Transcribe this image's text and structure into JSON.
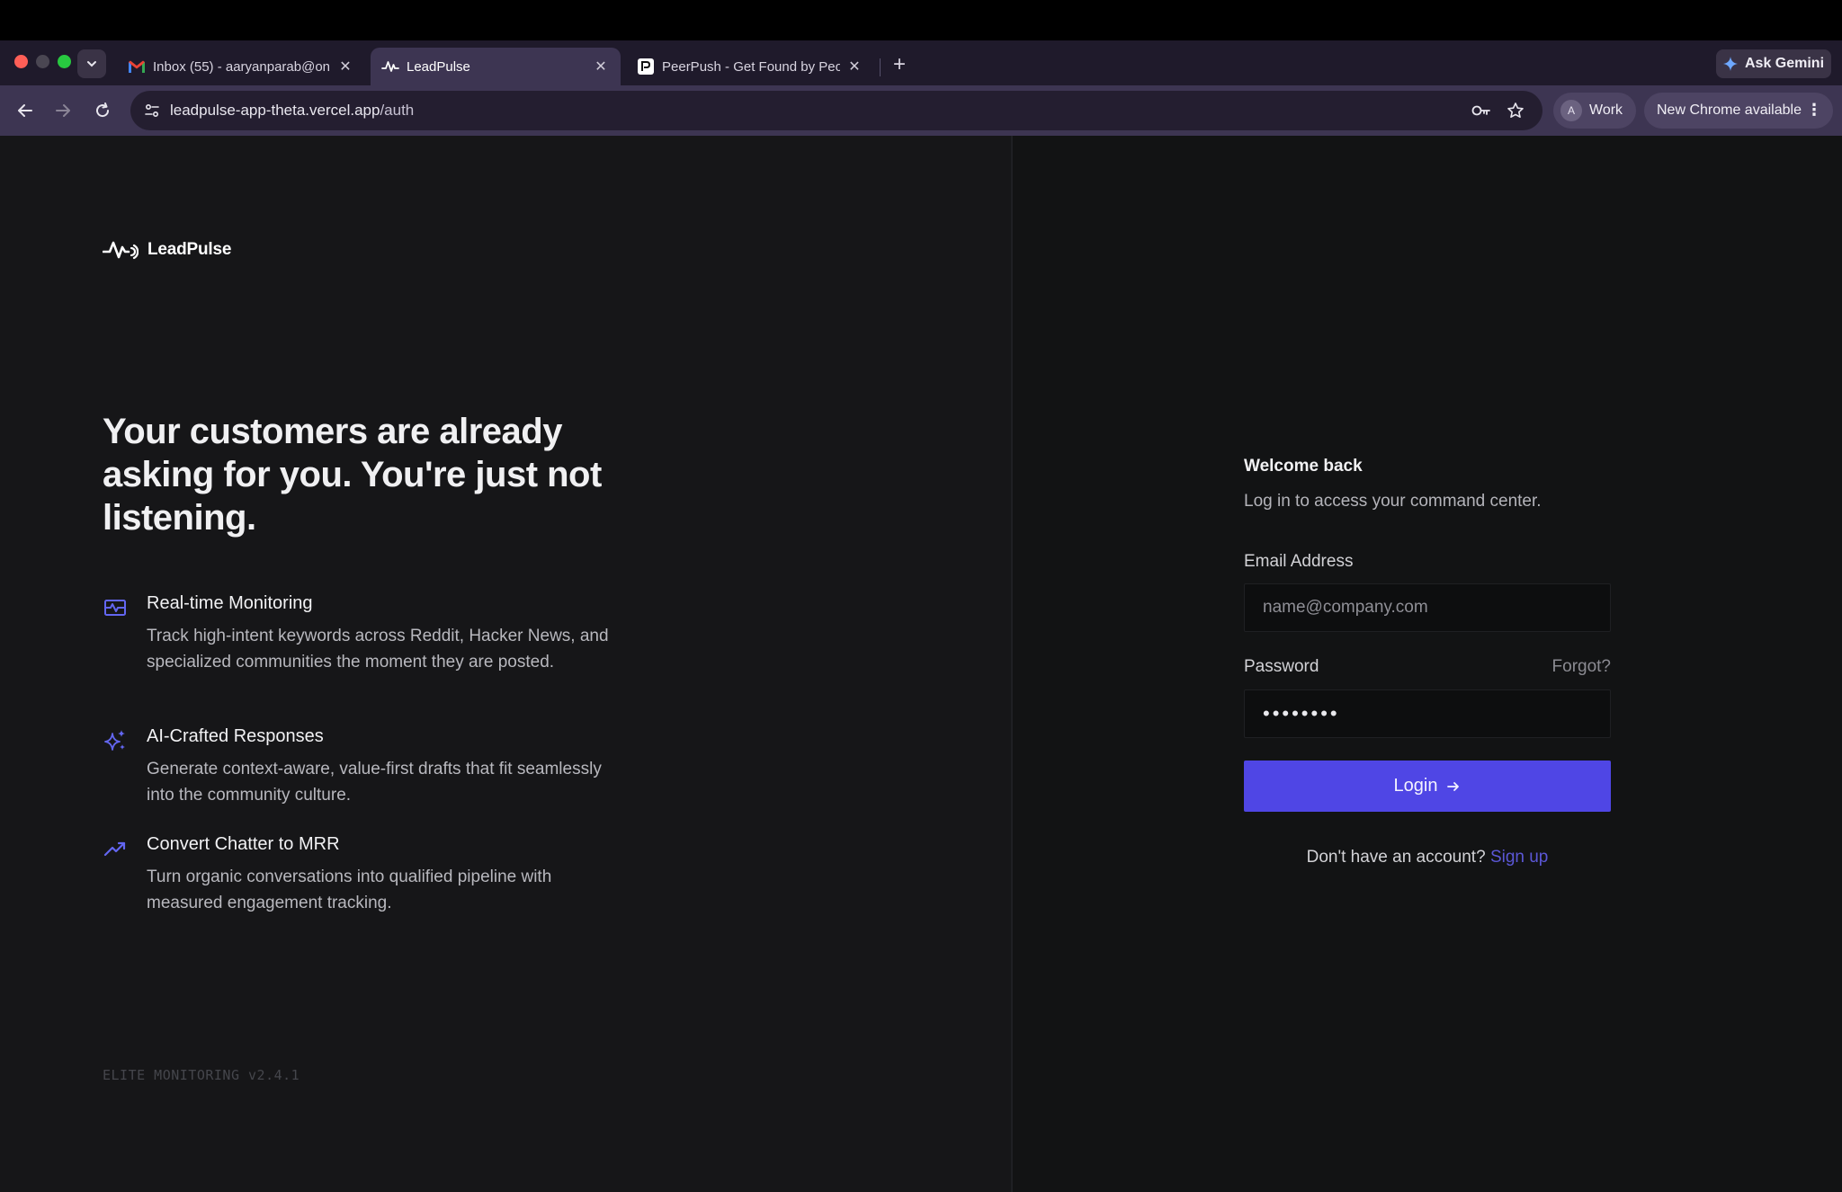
{
  "browser": {
    "tabs": [
      {
        "title": "Inbox (55) - aaryanparab@on",
        "active": false,
        "icon": "gmail-icon"
      },
      {
        "title": "LeadPulse",
        "active": true,
        "icon": "pulse-icon"
      },
      {
        "title": "PeerPush - Get Found by Peo",
        "active": false,
        "icon": "peerpush-icon"
      }
    ],
    "new_tab_label": "+",
    "ask_gemini_label": "Ask Gemini",
    "url_host": "leadpulse-app-theta.vercel.app",
    "url_path": "/auth",
    "profile_initial": "A",
    "profile_label": "Work",
    "update_label": "New Chrome available"
  },
  "brand": {
    "name": "LeadPulse"
  },
  "hero": {
    "headline": "Your customers are already asking for you. You're just not listening."
  },
  "features": [
    {
      "title": "Real-time Monitoring",
      "description": "Track high-intent keywords across Reddit, Hacker News, and specialized communities the moment they are posted.",
      "icon": "monitoring-icon"
    },
    {
      "title": "AI-Crafted Responses",
      "description": "Generate context-aware, value-first drafts that fit seamlessly into the community culture.",
      "icon": "sparkles-icon"
    },
    {
      "title": "Convert Chatter to MRR",
      "description": "Turn organic conversations into qualified pipeline with measured engagement tracking.",
      "icon": "trending-up-icon"
    }
  ],
  "version_text": "ELITE MONITORING v2.4.1",
  "login": {
    "title": "Welcome back",
    "subtitle": "Log in to access your command center.",
    "email_label": "Email Address",
    "email_placeholder": "name@company.com",
    "password_label": "Password",
    "forgot_label": "Forgot?",
    "password_value": "••••••••",
    "login_label": "Login",
    "signup_prompt": "Don't have an account?",
    "signup_label": "Sign up"
  },
  "colors": {
    "accent": "#4f46e5",
    "link": "#5b57d6",
    "icon_accent": "#6366f1"
  }
}
